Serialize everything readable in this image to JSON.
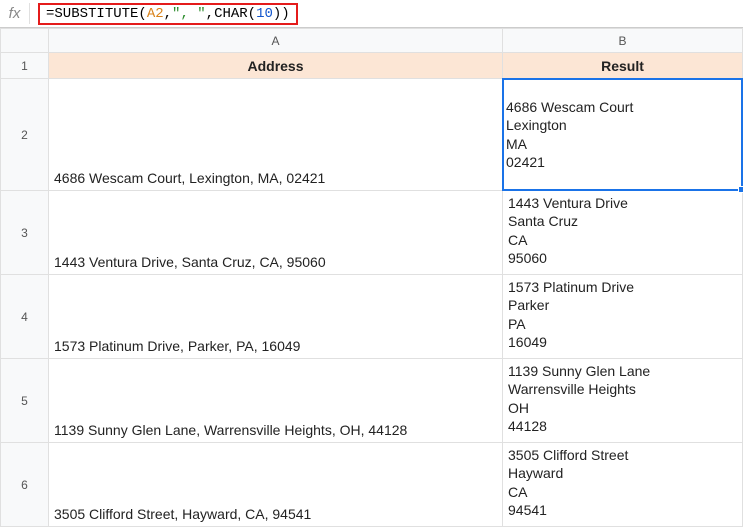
{
  "formula_bar": {
    "fx": "fx",
    "parts": {
      "eq": "=",
      "fn1": "SUBSTITUTE",
      "op": "(",
      "ref": "A2",
      "c1": ",",
      "str": "\", \"",
      "c2": ",",
      "fn2": "CHAR",
      "op2": "(",
      "num": "10",
      "cp2": ")",
      "cp": ")"
    }
  },
  "columns": {
    "a": "A",
    "b": "B"
  },
  "headers": {
    "address": "Address",
    "result": "Result"
  },
  "rows": [
    {
      "n": "1"
    },
    {
      "n": "2",
      "address": "4686 Wescam Court, Lexington, MA, 02421",
      "result": "4686 Wescam Court\nLexington\nMA\n02421"
    },
    {
      "n": "3",
      "address": "1443 Ventura Drive, Santa Cruz, CA, 95060",
      "result": "1443 Ventura Drive\nSanta Cruz\nCA\n95060"
    },
    {
      "n": "4",
      "address": "1573 Platinum Drive, Parker, PA, 16049",
      "result": "1573 Platinum Drive\nParker\nPA\n16049"
    },
    {
      "n": "5",
      "address": "1139 Sunny Glen Lane, Warrensville Heights, OH, 44128",
      "result": "1139 Sunny Glen Lane\nWarrensville Heights\nOH\n44128"
    },
    {
      "n": "6",
      "address": "3505 Clifford Street, Hayward, CA, 94541",
      "result": "3505 Clifford Street\nHayward\nCA\n94541"
    }
  ],
  "chart_data": {
    "type": "table",
    "columns": [
      "Address",
      "Result"
    ],
    "rows": [
      [
        "4686 Wescam Court, Lexington, MA, 02421",
        "4686 Wescam Court\nLexington\nMA\n02421"
      ],
      [
        "1443 Ventura Drive, Santa Cruz, CA, 95060",
        "1443 Ventura Drive\nSanta Cruz\nCA\n95060"
      ],
      [
        "1573 Platinum Drive, Parker, PA, 16049",
        "1573 Platinum Drive\nParker\nPA\n16049"
      ],
      [
        "1139 Sunny Glen Lane, Warrensville Heights, OH, 44128",
        "1139 Sunny Glen Lane\nWarrensville Heights\nOH\n44128"
      ],
      [
        "3505 Clifford Street, Hayward, CA, 94541",
        "3505 Clifford Street\nHayward\nCA\n94541"
      ]
    ],
    "formula": "=SUBSTITUTE(A2,\", \",CHAR(10))"
  }
}
